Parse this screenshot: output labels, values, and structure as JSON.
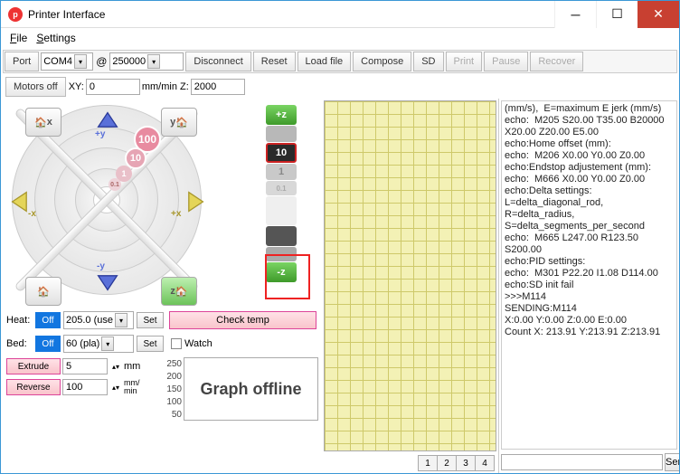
{
  "window": {
    "title": "Printer Interface"
  },
  "menu": {
    "file": "File",
    "settings": "Settings"
  },
  "toolbar": {
    "port": "Port",
    "com": "COM4",
    "at": "@",
    "baud": "250000",
    "disconnect": "Disconnect",
    "reset": "Reset",
    "loadfile": "Load file",
    "compose": "Compose",
    "sd": "SD",
    "print": "Print",
    "pause": "Pause",
    "recover": "Recover"
  },
  "row2": {
    "motorsoff": "Motors off",
    "xy": "XY:",
    "xyval": "0",
    "mmmin": "mm/min Z:",
    "zval": "2000"
  },
  "jog": {
    "home_x": "x",
    "home_y": "y",
    "home_z": "z",
    "px": "+x",
    "nx": "-x",
    "py": "+y",
    "ny": "-y",
    "pz": "+z",
    "nz": "-z",
    "n100": "100",
    "n10": "10",
    "n1": "1",
    "n01": "0.1"
  },
  "heat": {
    "heat_label": "Heat:",
    "bed_label": "Bed:",
    "off": "Off",
    "heat_preset": "205.0 (use",
    "bed_preset": "60 (pla)",
    "set": "Set",
    "checktemp": "Check temp",
    "watch": "Watch"
  },
  "ext": {
    "extrude": "Extrude",
    "reverse": "Reverse",
    "ext_len": "5",
    "rev_len": "100",
    "mm": "mm",
    "mm_min": "mm/\nmin"
  },
  "graph": {
    "ticks": [
      "250",
      "200",
      "150",
      "100",
      "50"
    ],
    "offline": "Graph offline"
  },
  "tabs": [
    "1",
    "2",
    "3",
    "4"
  ],
  "console_lines": "(mm/s),  E=maximum E jerk (mm/s)\necho:  M205 S20.00 T35.00 B20000 X20.00 Z20.00 E5.00\necho:Home offset (mm):\necho:  M206 X0.00 Y0.00 Z0.00\necho:Endstop adjustement (mm):\necho:  M666 X0.00 Y0.00 Z0.00\necho:Delta settings: L=delta_diagonal_rod, R=delta_radius, S=delta_segments_per_second\necho:  M665 L247.00 R123.50 S200.00\necho:PID settings:\necho:  M301 P22.20 I1.08 D114.00\necho:SD init fail\n>>>M114\nSENDING:M114\nX:0.00 Y:0.00 Z:0.00 E:0.00\nCount X: 213.91 Y:213.91 Z:213.91",
  "send": {
    "label": "Send"
  }
}
